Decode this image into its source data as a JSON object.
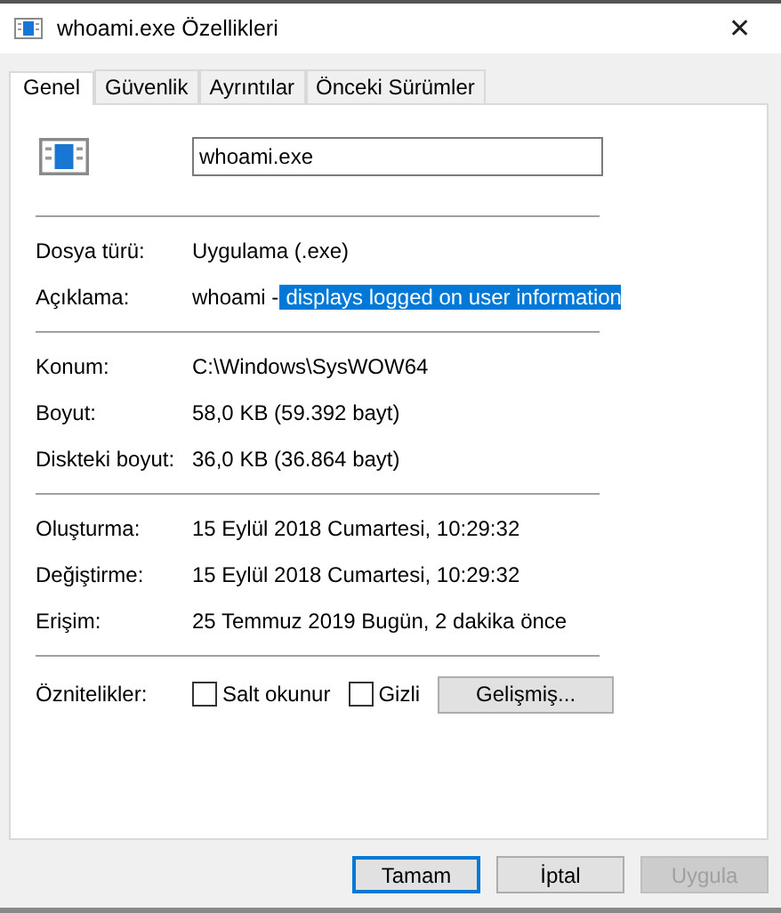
{
  "window": {
    "title": "whoami.exe Özellikleri",
    "close": "✕"
  },
  "tabs": [
    {
      "label": "Genel",
      "selected": true
    },
    {
      "label": "Güvenlik",
      "selected": false
    },
    {
      "label": "Ayrıntılar",
      "selected": false
    },
    {
      "label": "Önceki Sürümler",
      "selected": false
    }
  ],
  "name_field": {
    "value": "whoami.exe"
  },
  "sections": [
    {
      "rows": [
        {
          "label": "Dosya türü:",
          "value": "Uygulama (.exe)"
        },
        {
          "label": "Açıklama:",
          "value": "whoami -",
          "selected_text": "displays logged on user information"
        }
      ]
    },
    {
      "rows": [
        {
          "label": "Konum:",
          "value": "C:\\Windows\\SysWOW64"
        },
        {
          "label": "Boyut:",
          "value": "58,0 KB (59.392 bayt)"
        },
        {
          "label": "Diskteki boyut:",
          "value": "36,0 KB (36.864 bayt)"
        }
      ]
    },
    {
      "rows": [
        {
          "label": "Oluşturma:",
          "value": "15 Eylül 2018 Cumartesi, 10:29:32"
        },
        {
          "label": "Değiştirme:",
          "value": "15 Eylül 2018 Cumartesi, 10:29:32"
        },
        {
          "label": "Erişim:",
          "value": "25 Temmuz 2019 Bugün, 2 dakika önce"
        }
      ]
    }
  ],
  "attributes": {
    "label": "Öznitelikler:",
    "checkboxes": [
      {
        "label": "Salt okunur",
        "checked": false
      },
      {
        "label": "Gizli",
        "checked": false
      }
    ],
    "button": "Gelişmiş..."
  },
  "buttons": [
    {
      "label": "Tamam",
      "default": true,
      "disabled": false
    },
    {
      "label": "İptal",
      "default": false,
      "disabled": false
    },
    {
      "label": "Uygula",
      "default": false,
      "disabled": true
    }
  ]
}
